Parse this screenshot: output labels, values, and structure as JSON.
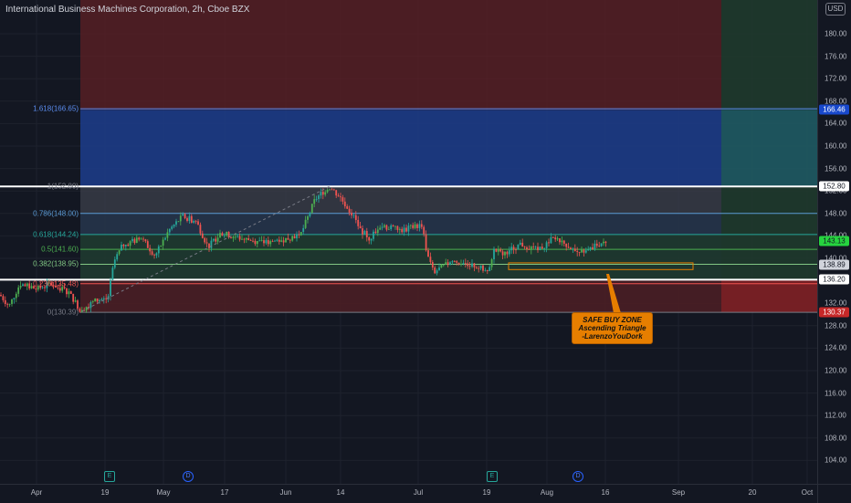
{
  "header": {
    "title": "International Business Machines Corporation, 2h, Cboe BZX"
  },
  "currency_label": "USD",
  "price_axis": {
    "ticks": [
      "180.00",
      "176.00",
      "172.00",
      "168.00",
      "164.00",
      "160.00",
      "156.00",
      "152.00",
      "148.00",
      "144.00",
      "140.00",
      "136.00",
      "132.00",
      "128.00",
      "124.00",
      "120.00",
      "116.00",
      "112.00",
      "108.00",
      "104.00"
    ],
    "tick_values": [
      180,
      176,
      172,
      168,
      164,
      160,
      156,
      152,
      148,
      144,
      140,
      136,
      132,
      128,
      124,
      120,
      116,
      112,
      108,
      104
    ]
  },
  "time_axis": {
    "labels": [
      "Apr",
      "19",
      "May",
      "17",
      "Jun",
      "14",
      "Jul",
      "19",
      "Aug",
      "16",
      "Sep",
      "20",
      "Oct"
    ]
  },
  "price_tags": [
    {
      "text": "166.46",
      "value": 166.46,
      "bg": "#1848cc",
      "fg": "#ffffff"
    },
    {
      "text": "152.80",
      "value": 152.8,
      "bg": "#ffffff",
      "fg": "#131722"
    },
    {
      "text": "143.13",
      "value": 143.13,
      "bg": "#26d33f",
      "fg": "#131722"
    },
    {
      "text": "138.89",
      "value": 138.89,
      "bg": "#d1d4dc",
      "fg": "#131722"
    },
    {
      "text": "136.20",
      "value": 136.2,
      "bg": "#ffffff",
      "fg": "#131722"
    },
    {
      "text": "130.37",
      "value": 130.37,
      "bg": "#c62828",
      "fg": "#ffffff"
    }
  ],
  "fib_levels": [
    {
      "label": "1.618(166.65)",
      "value": 166.65,
      "color": "#5b8def"
    },
    {
      "label": "1(152.80)",
      "value": 152.8,
      "color": "#787b86"
    },
    {
      "label": "0.786(148.00)",
      "value": 148.0,
      "color": "#5b9bd5"
    },
    {
      "label": "0.618(144.24)",
      "value": 144.24,
      "color": "#26a69a"
    },
    {
      "label": "0.5(141.60)",
      "value": 141.6,
      "color": "#4caf50"
    },
    {
      "label": "0.382(138.95)",
      "value": 138.95,
      "color": "#81c784"
    },
    {
      "label": "0.236(135.48)",
      "value": 135.48,
      "color": "#ef5350"
    },
    {
      "label": "0(130.39)",
      "value": 130.39,
      "color": "#787b86"
    }
  ],
  "annotation": {
    "line1": "SAFE BUY ZONE",
    "line2": "Ascending Triangle",
    "line3": "-LarenzoYouDork"
  },
  "event_markers": [
    {
      "symbol": "E",
      "kind": "earnings"
    },
    {
      "symbol": "D",
      "kind": "dividend"
    },
    {
      "symbol": "E",
      "kind": "earnings"
    },
    {
      "symbol": "D",
      "kind": "dividend"
    }
  ],
  "colors": {
    "background": "#131722",
    "up": "#26a69a",
    "up_bright": "#4caf50",
    "down": "#ef5350",
    "callout": "#e67e00"
  },
  "chart_data": {
    "type": "candlestick",
    "title": "International Business Machines Corporation, 2h, Cboe BZX",
    "y_unit": "USD",
    "ylim": [
      102,
      184
    ],
    "x_labels": [
      "Apr",
      "19",
      "May",
      "17",
      "Jun",
      "14",
      "Jul",
      "19",
      "Aug",
      "16",
      "Sep",
      "20",
      "Oct"
    ],
    "close_path": [
      [
        "Apr 1",
        133.5
      ],
      [
        "Apr 5",
        135.5
      ],
      [
        "Apr 9",
        134.5
      ],
      [
        "Apr 13",
        131.0
      ],
      [
        "Apr 16",
        133.0
      ],
      [
        "Apr 19",
        139.5
      ],
      [
        "Apr 22",
        142.5
      ],
      [
        "Apr 26",
        143.0
      ],
      [
        "May 1",
        145.5
      ],
      [
        "May 6",
        146.0
      ],
      [
        "May 10",
        147.5
      ],
      [
        "May 13",
        143.5
      ],
      [
        "May 17",
        142.0
      ],
      [
        "May 21",
        144.5
      ],
      [
        "May 26",
        143.5
      ],
      [
        "May 31",
        144.0
      ],
      [
        "Jun 4",
        144.5
      ],
      [
        "Jun 8",
        148.5
      ],
      [
        "Jun 11",
        151.5
      ],
      [
        "Jun 14",
        150.5
      ],
      [
        "Jun 17",
        147.5
      ],
      [
        "Jun 21",
        144.5
      ],
      [
        "Jun 23",
        143.5
      ],
      [
        "Jun 28",
        146.0
      ],
      [
        "Jul 1",
        146.5
      ],
      [
        "Jul 6",
        139.0
      ],
      [
        "Jul 12",
        139.5
      ],
      [
        "Jul 16",
        139.0
      ],
      [
        "Jul 19",
        137.0
      ],
      [
        "Jul 21",
        141.5
      ],
      [
        "Jul 26",
        141.8
      ],
      [
        "Jul 30",
        142.5
      ],
      [
        "Aug 3",
        141.5
      ],
      [
        "Aug 6",
        143.5
      ],
      [
        "Aug 9",
        141.2
      ],
      [
        "Aug 13",
        143.1
      ]
    ],
    "last_price": 143.13,
    "previous_close": 138.89,
    "levels": {
      "resistance": 152.8,
      "support": 136.2,
      "fib_1_618": 166.65,
      "pattern_target": 166.46,
      "stop": 130.37
    },
    "fibonacci": [
      {
        "ratio": "1.618",
        "value": 166.65
      },
      {
        "ratio": "1",
        "value": 152.8
      },
      {
        "ratio": "0.786",
        "value": 148.0
      },
      {
        "ratio": "0.618",
        "value": 144.24
      },
      {
        "ratio": "0.5",
        "value": 141.6
      },
      {
        "ratio": "0.382",
        "value": 138.95
      },
      {
        "ratio": "0.236",
        "value": 135.48
      },
      {
        "ratio": "0",
        "value": 130.39
      }
    ],
    "buy_zone": {
      "low": 138.0,
      "high": 139.2
    },
    "grid": true
  }
}
